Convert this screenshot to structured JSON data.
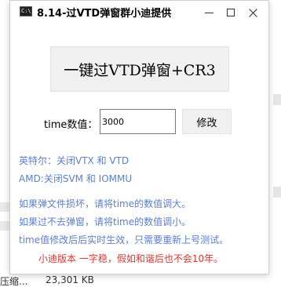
{
  "background": {
    "file_type_text": "压缩...",
    "file_size_text": "23,301 KB"
  },
  "window": {
    "icon_label": "C:\\",
    "title": "8.14-过VTD弹窗群小迪提供",
    "controls": {
      "minimize": "minimize",
      "maximize": "maximize",
      "close": "close"
    }
  },
  "main": {
    "big_button_label": "一键过VTD弹窗+CR3",
    "time_label": "time数值：",
    "time_value": "3000",
    "modify_button_label": "修改"
  },
  "notes": {
    "line1": "英特尔：关闭VTX 和 VTD",
    "line2": "AMD:关闭SVM 和 IOMMU",
    "line3": "如果弹文件损坏，请将time的数值调大。",
    "line4": "如果过不去弹窗，请将time的数值调小。",
    "line5": "time值修改后后实时生效，只需要重新上号测试。",
    "line6": "小迪版本 一字稳，假如和谐后也不会10年。"
  },
  "colors": {
    "note_blue": "#5b7fd3",
    "note_red": "#e5322b",
    "button_bg": "#f0f0f0"
  }
}
